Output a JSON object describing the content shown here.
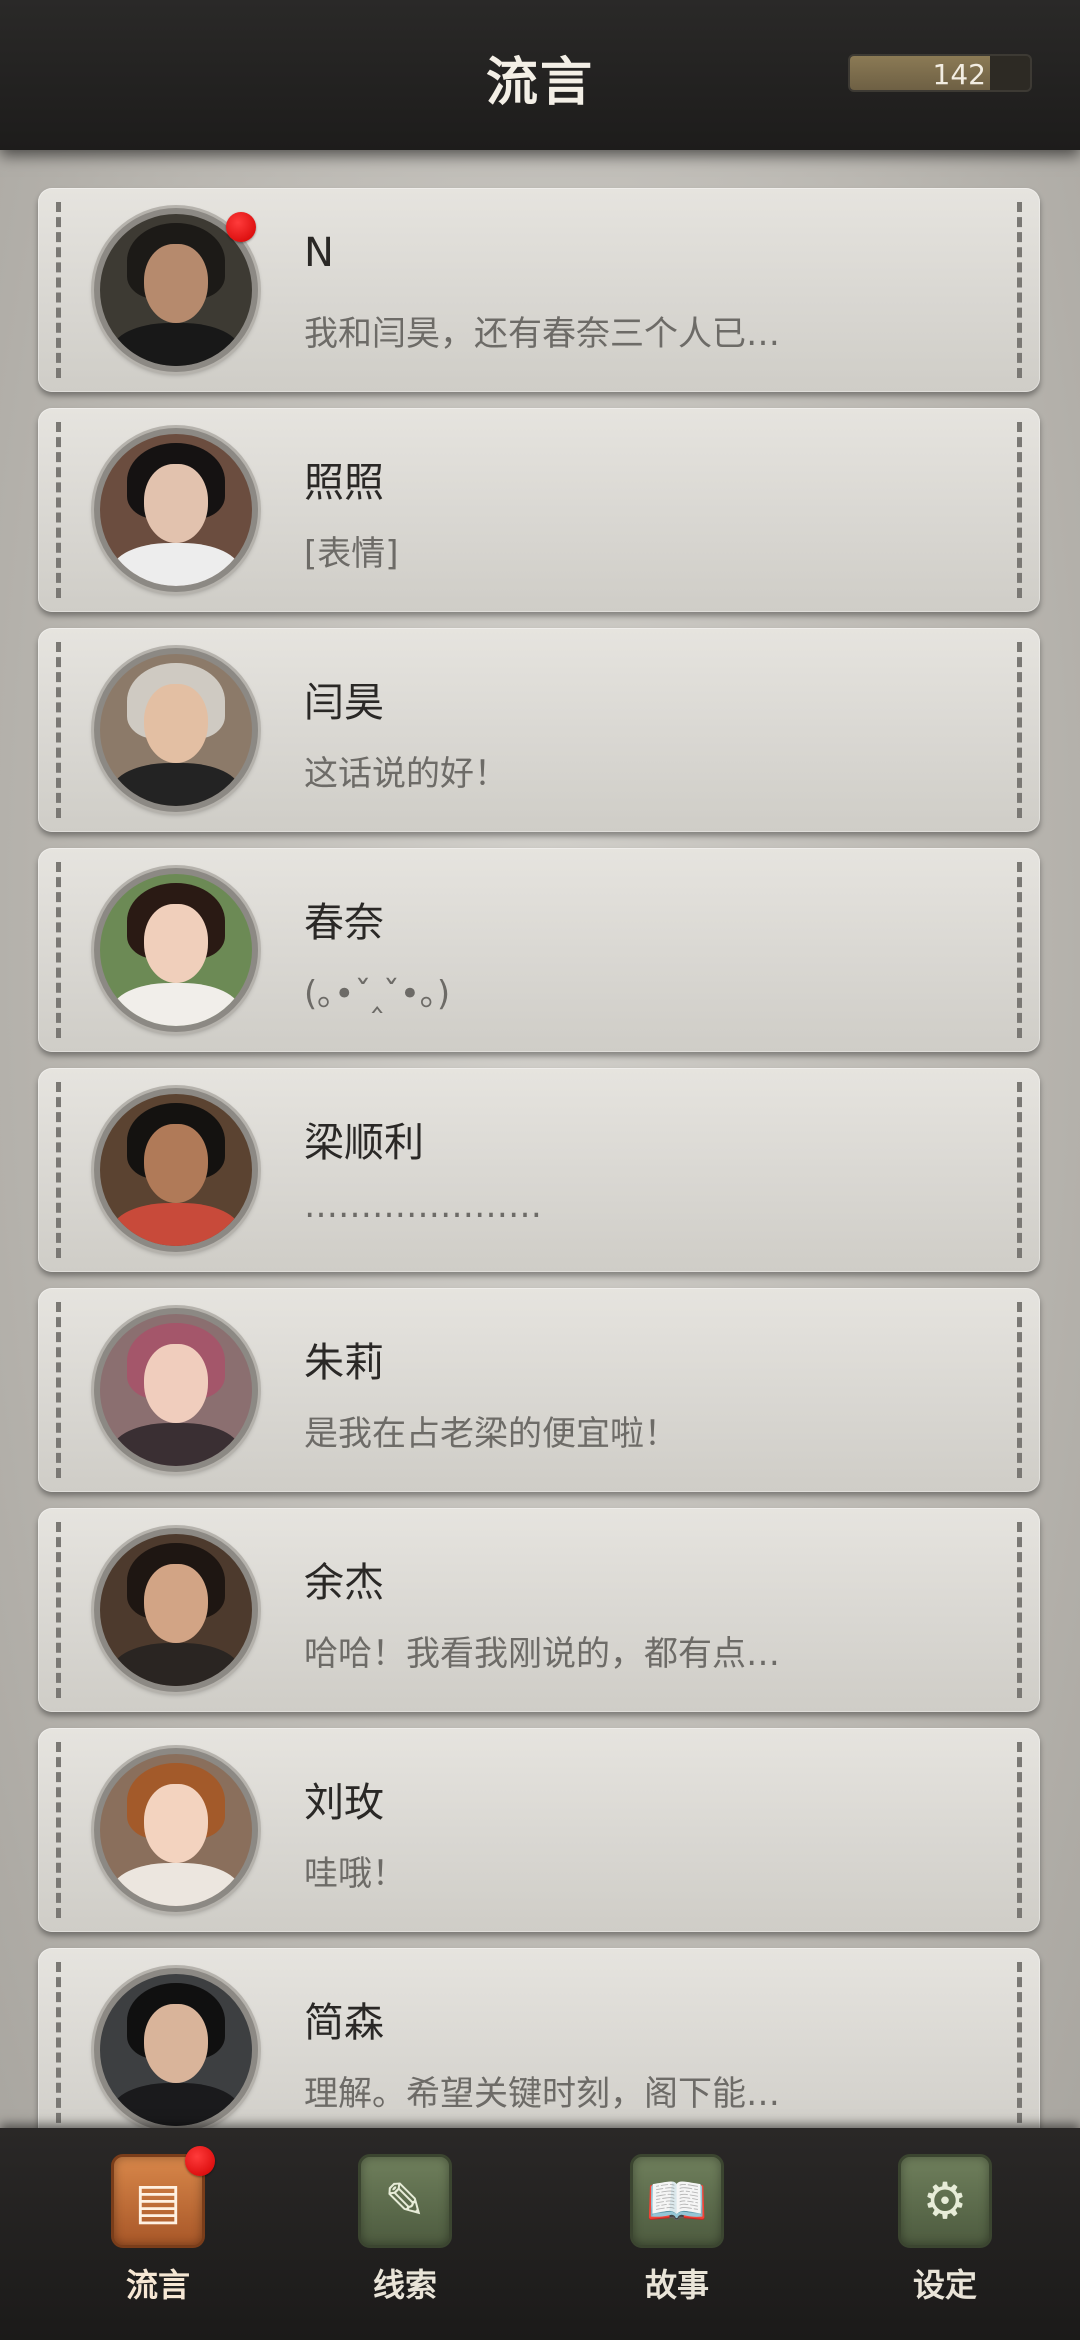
{
  "header": {
    "title": "流言",
    "currency": {
      "value": "142",
      "level": 0.78
    }
  },
  "contacts": [
    {
      "name": "N",
      "preview": "我和闫昊，还有春奈三个人已…",
      "unread": true,
      "colors": {
        "bg": "#3d3a33",
        "hair": "#1c1a17",
        "face": "#b68a6d",
        "body": "#181818"
      }
    },
    {
      "name": "照照",
      "preview": "[表情]",
      "unread": false,
      "colors": {
        "bg": "#6b4d3f",
        "hair": "#151212",
        "face": "#e2c2ae",
        "body": "#ededed"
      }
    },
    {
      "name": "闫昊",
      "preview": "这话说的好！",
      "unread": false,
      "colors": {
        "bg": "#8c7a69",
        "hair": "#cfcac2",
        "face": "#e3bfa3",
        "body": "#232323"
      }
    },
    {
      "name": "春奈",
      "preview": "(｡•ˇ‸ˇ•｡)",
      "unread": false,
      "colors": {
        "bg": "#6c8a55",
        "hair": "#2a1a14",
        "face": "#f0cfbb",
        "body": "#f1eeea"
      }
    },
    {
      "name": "梁顺利",
      "preview": "…………………",
      "unread": false,
      "colors": {
        "bg": "#5b4331",
        "hair": "#141210",
        "face": "#b07a58",
        "body": "#c84a3a"
      }
    },
    {
      "name": "朱莉",
      "preview": "是我在占老梁的便宜啦！",
      "unread": false,
      "colors": {
        "bg": "#8b6f70",
        "hair": "#a4566a",
        "face": "#f0cdbd",
        "body": "#3a2f33"
      }
    },
    {
      "name": "余杰",
      "preview": "哈哈！我看我刚说的，都有点…",
      "unread": false,
      "colors": {
        "bg": "#4d3a2d",
        "hair": "#1e1612",
        "face": "#d2a485",
        "body": "#2a2522"
      }
    },
    {
      "name": "刘玫",
      "preview": "哇哦！",
      "unread": false,
      "colors": {
        "bg": "#8a6f5c",
        "hair": "#a35a2a",
        "face": "#f3d3bf",
        "body": "#ece6df"
      }
    },
    {
      "name": "简森",
      "preview": "理解。希望关键时刻，阁下能…",
      "unread": false,
      "colors": {
        "bg": "#3d3f41",
        "hair": "#101010",
        "face": "#d9b49a",
        "body": "#1a1a1c"
      }
    }
  ],
  "nav": [
    {
      "label": "流言",
      "icon": "document-icon",
      "glyph": "▤",
      "active": true,
      "unread": true
    },
    {
      "label": "线索",
      "icon": "notepad-pen-icon",
      "glyph": "✎",
      "active": false,
      "unread": false
    },
    {
      "label": "故事",
      "icon": "open-book-icon",
      "glyph": "📖",
      "active": false,
      "unread": false
    },
    {
      "label": "设定",
      "icon": "gears-icon",
      "glyph": "⚙",
      "active": false,
      "unread": false
    }
  ]
}
